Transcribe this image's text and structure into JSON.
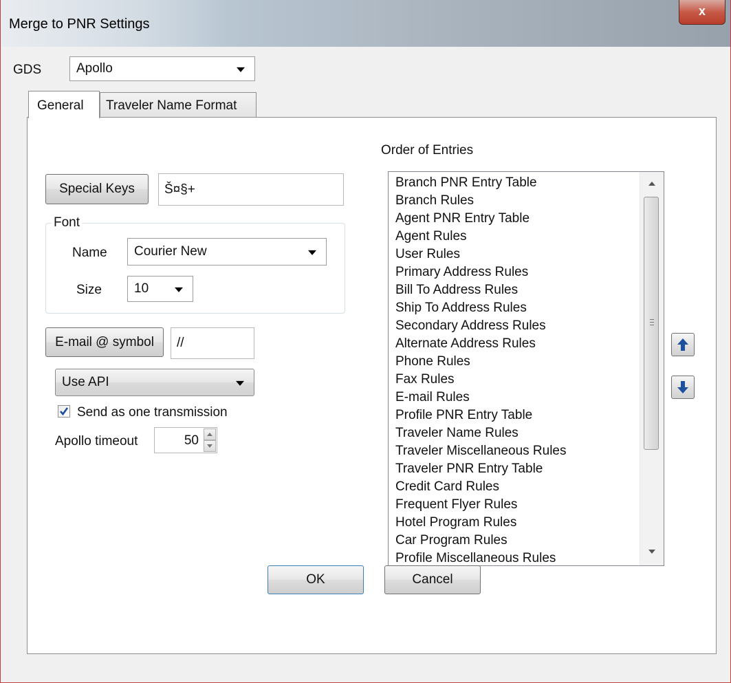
{
  "window": {
    "title": "Merge to PNR Settings",
    "close_glyph": "x"
  },
  "gds": {
    "label": "GDS",
    "value": "Apollo"
  },
  "tabs": [
    {
      "label": "General",
      "selected": true
    },
    {
      "label": "Traveler Name Format",
      "selected": false
    }
  ],
  "general": {
    "special_keys": {
      "button_label": "Special Keys",
      "value": "Š¤§+"
    },
    "font": {
      "group_label": "Font",
      "name_label": "Name",
      "name_value": "Courier New",
      "size_label": "Size",
      "size_value": "10"
    },
    "email": {
      "button_label": "E-mail @ symbol",
      "value": "//"
    },
    "transmission": {
      "value": "Use API"
    },
    "send_one": {
      "label": "Send as one transmission",
      "checked": true
    },
    "timeout": {
      "label": "Apollo timeout",
      "value": "50"
    },
    "order": {
      "label": "Order of Entries",
      "items": [
        "Branch PNR Entry Table",
        "Branch Rules",
        "Agent PNR Entry Table",
        "Agent Rules",
        "User Rules",
        "Primary Address Rules",
        "Bill To Address Rules",
        "Ship To Address Rules",
        "Secondary Address Rules",
        "Alternate Address Rules",
        "Phone Rules",
        "Fax Rules",
        "E-mail Rules",
        "Profile PNR Entry Table",
        "Traveler Name Rules",
        "Traveler Miscellaneous Rules",
        "Traveler PNR Entry Table",
        "Credit Card Rules",
        "Frequent Flyer Rules",
        "Hotel Program Rules",
        "Car Program Rules",
        "Profile Miscellaneous Rules"
      ]
    },
    "move_up_icon": "arrow-up",
    "move_down_icon": "arrow-down",
    "accent_color": "#1c4f9e"
  },
  "footer": {
    "ok_label": "OK",
    "cancel_label": "Cancel"
  }
}
